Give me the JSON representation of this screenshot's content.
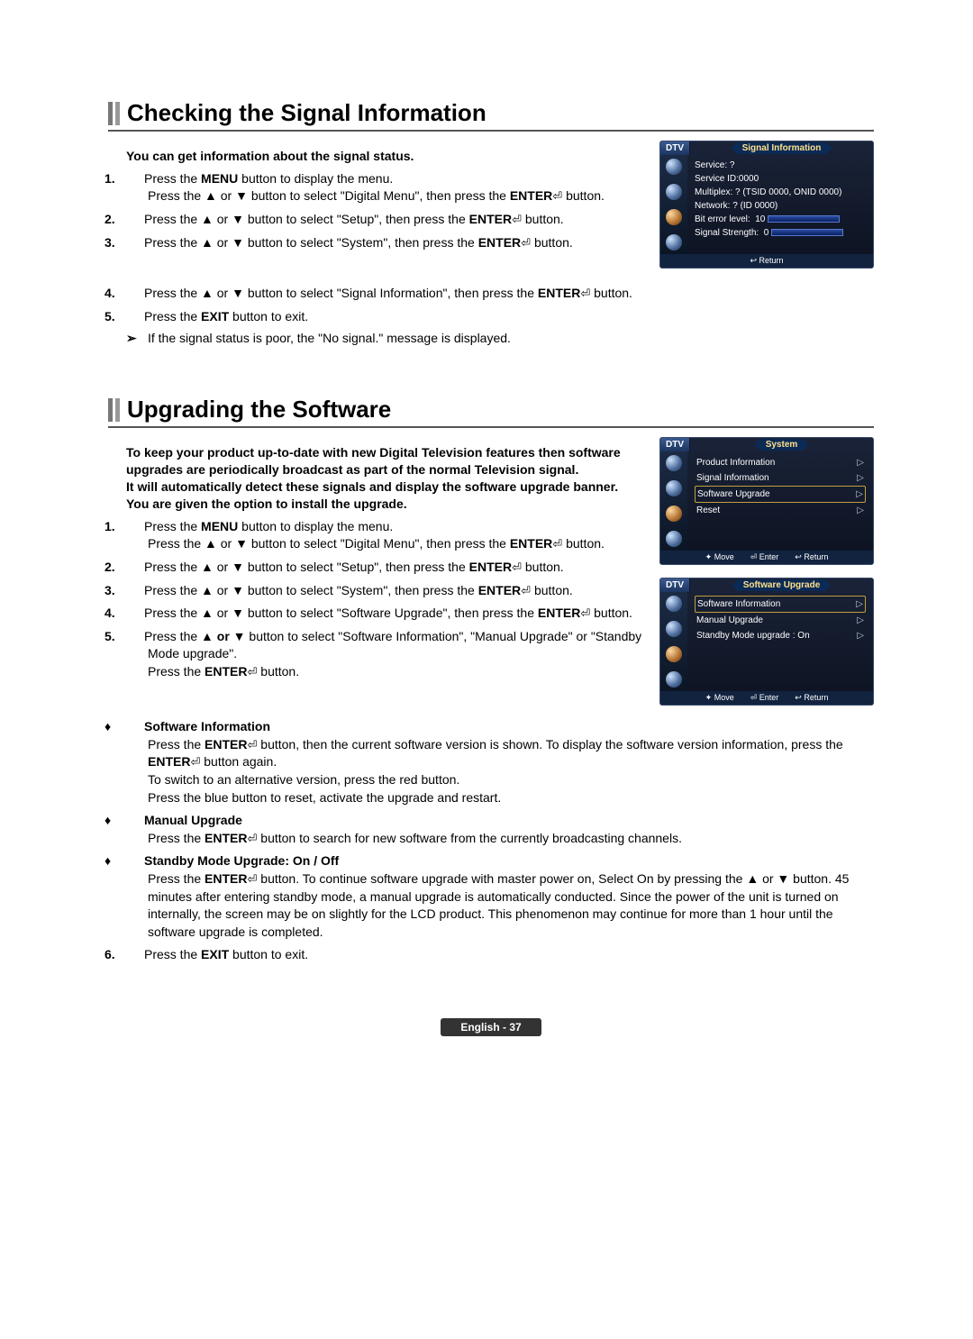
{
  "section1": {
    "title": "Checking the Signal Information",
    "intro": "You can get information about the signal status.",
    "steps": [
      "Press the MENU button to display the menu. Press the ▲ or ▼ button to select \"Digital Menu\", then press the ENTER⏎ button.",
      "Press the ▲ or ▼ button to select \"Setup\", then press the ENTER⏎ button.",
      "Press the ▲ or ▼ button to select \"System\", then press the ENTER⏎ button.",
      "Press the ▲ or ▼ button to select \"Signal Information\", then press the ENTER⏎ button.",
      "Press the EXIT button to exit."
    ],
    "note": "If the signal status is poor, the \"No signal.\" message is displayed."
  },
  "section2": {
    "title": "Upgrading the Software",
    "intro": "To keep your product up-to-date with new Digital Television features then software upgrades are periodically broadcast as part of the normal Television signal.\nIt will automatically detect these signals and display the software upgrade banner. You are given the option to install the upgrade.",
    "steps": [
      "Press the MENU button to display the menu. Press the ▲ or ▼ button to select \"Digital Menu\", then press the ENTER⏎ button.",
      "Press the ▲ or ▼ button to select \"Setup\", then press the ENTER⏎ button.",
      "Press the ▲ or ▼ button to select \"System\", then press the ENTER⏎ button.",
      "Press the ▲ or ▼ button to select \"Software Upgrade\", then press the ENTER⏎ button.",
      "Press the ▲ or ▼ button to select \"Software Information\", \"Manual Upgrade\" or \"Standby Mode upgrade\". Press the ENTER⏎ button."
    ],
    "bullets": [
      {
        "title": "Software Information",
        "body": "Press the ENTER⏎ button, then the current software version is shown. To display the software version information, press the ENTER⏎ button again.\nTo switch to an alternative version, press the red button.\nPress the blue button to reset, activate the upgrade and restart."
      },
      {
        "title": "Manual Upgrade",
        "body": "Press the ENTER⏎ button to search for new software from the currently broadcasting channels."
      },
      {
        "title": "Standby Mode Upgrade: On / Off",
        "body": "Press the ENTER⏎ button. To continue software upgrade with master power on, Select On by pressing the ▲ or ▼ button. 45 minutes after entering standby mode, a manual upgrade is automatically conducted. Since the power of the unit is turned on internally, the screen may be on slightly for the LCD product. This phenomenon may continue for more than 1 hour until the software upgrade is completed."
      }
    ],
    "step6": "Press the EXIT button to exit."
  },
  "osd1": {
    "tab": "DTV",
    "title": "Signal Information",
    "lines": {
      "service": "Service: ?",
      "serviceId": "Service ID:0000",
      "multiplex": "Multiplex: ? (TSID 0000, ONID 0000)",
      "network": "Network: ? (ID 0000)",
      "bitLabel": "Bit error level:",
      "bitVal": "10",
      "sigLabel": "Signal Strength:",
      "sigVal": "0"
    },
    "foot": "↩ Return"
  },
  "osd2": {
    "tab": "DTV",
    "title": "System",
    "items": [
      "Product Information",
      "Signal Information",
      "Software Upgrade",
      "Reset"
    ],
    "selectedIndex": 2,
    "footMove": "✦ Move",
    "footEnter": "⏎ Enter",
    "footReturn": "↩ Return"
  },
  "osd3": {
    "tab": "DTV",
    "title": "Software Upgrade",
    "items": [
      "Software Information",
      "Manual Upgrade",
      "Standby Mode upgrade : On"
    ],
    "selectedIndex": 0,
    "footMove": "✦ Move",
    "footEnter": "⏎ Enter",
    "footReturn": "↩ Return"
  },
  "footer": "English - 37"
}
